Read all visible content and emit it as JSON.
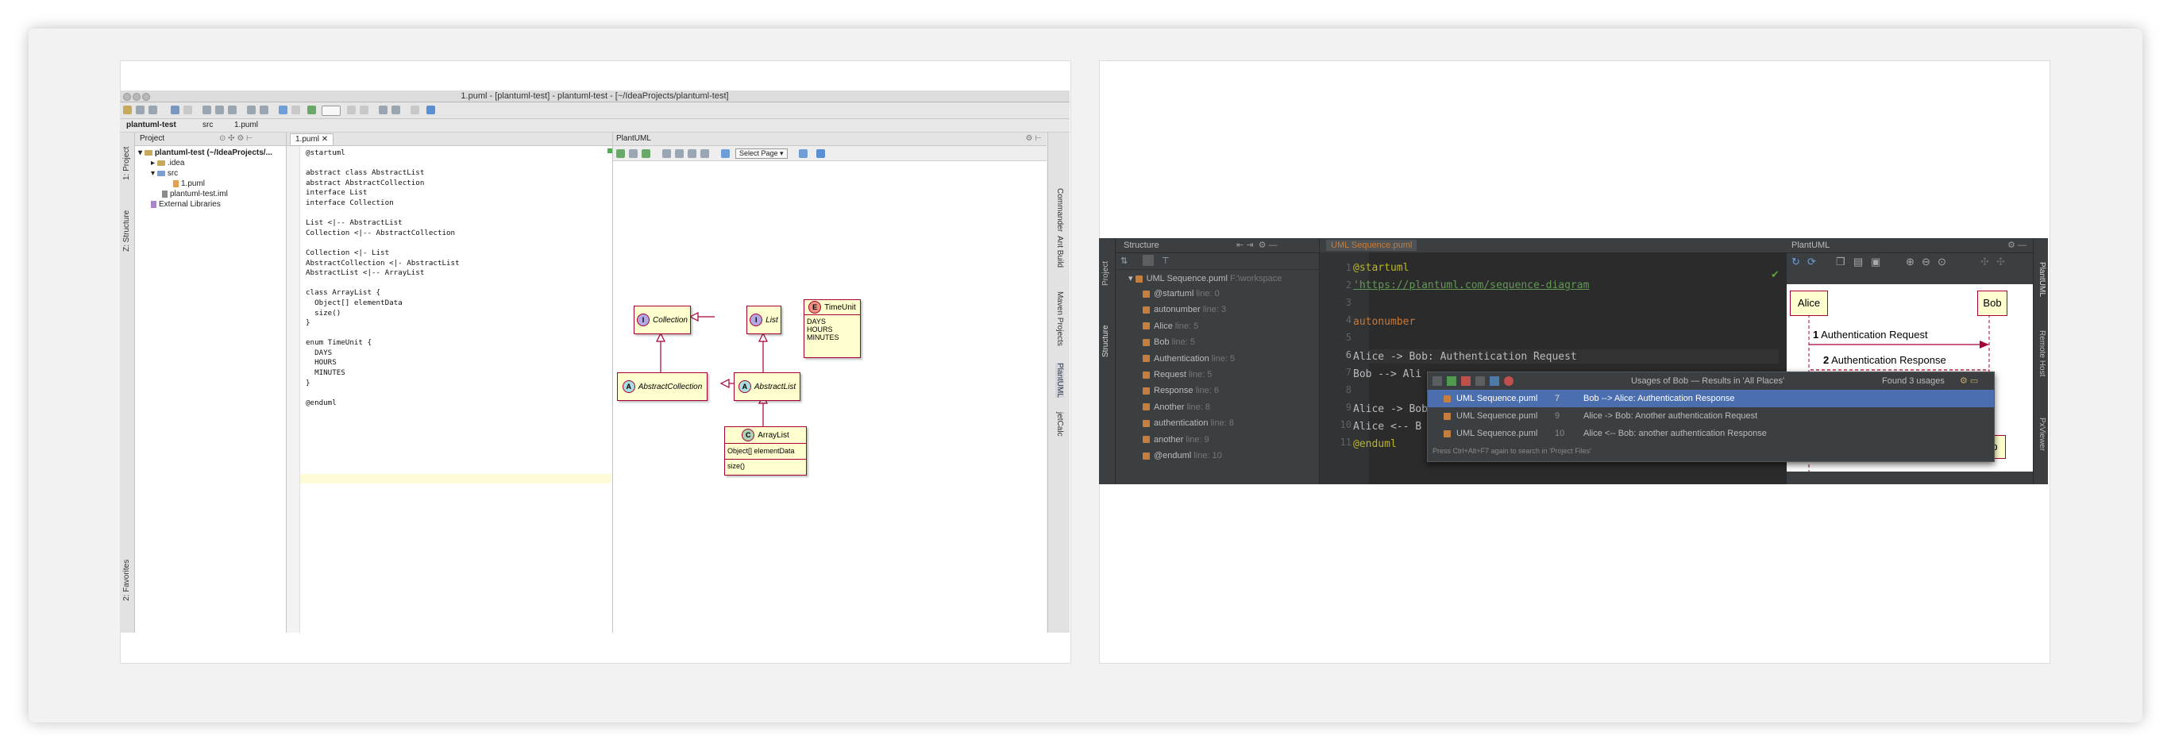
{
  "left_ide": {
    "window_title": "1.puml - [plantuml-test] - plantuml-test - [~/IdeaProjects/plantuml-test]",
    "breadcrumbs": [
      "plantuml-test",
      "src",
      "1.puml"
    ],
    "project_header": "Project",
    "left_tool_tabs": [
      "1: Project",
      "Z: Structure",
      "2: Favorites"
    ],
    "right_tool_tabs": [
      "Commander",
      "Ant Build",
      "Maven Projects",
      "PlantUML",
      "jetCalc"
    ],
    "tree": {
      "root": "plantuml-test (~/IdeaProjects/...",
      "idea": ".idea",
      "src": "src",
      "file": "1.puml",
      "iml": "plantuml-test.iml",
      "libs": "External Libraries"
    },
    "editor_tab": "1.puml",
    "code_lines": [
      "@startuml",
      "",
      "abstract class AbstractList",
      "abstract AbstractCollection",
      "interface List",
      "interface Collection",
      "",
      "List <|-- AbstractList",
      "Collection <|-- AbstractCollection",
      "",
      "Collection <|- List",
      "AbstractCollection <|- AbstractList",
      "AbstractList <|-- ArrayList",
      "",
      "class ArrayList {",
      "  Object[] elementData",
      "  size()",
      "}",
      "",
      "enum TimeUnit {",
      "  DAYS",
      "  HOURS",
      "  MINUTES",
      "}",
      "",
      "@enduml"
    ],
    "plantuml_header": "PlantUML",
    "select_page": "Select Page",
    "diagram": {
      "collection": "Collection",
      "list": "List",
      "timeunit": "TimeUnit",
      "timeunit_values": [
        "DAYS",
        "HOURS",
        "MINUTES"
      ],
      "abstract_collection": "AbstractCollection",
      "abstract_list": "AbstractList",
      "arraylist": "ArrayList",
      "arraylist_field": "Object[] elementData",
      "arraylist_method": "size()",
      "stereo_i": "I",
      "stereo_a": "A",
      "stereo_c": "C",
      "stereo_e": "E"
    }
  },
  "right_ide": {
    "left_tabs": [
      "Project",
      "Structure"
    ],
    "structure_header": "Structure",
    "structure_root": "UML Sequence.puml",
    "structure_root_path": "F:\\workspace",
    "structure_items": [
      {
        "name": "@startuml",
        "line": "line: 0"
      },
      {
        "name": "autonumber",
        "line": "line: 3"
      },
      {
        "name": "Alice",
        "line": "line: 5"
      },
      {
        "name": "Bob",
        "line": "line: 5"
      },
      {
        "name": "Authentication",
        "line": "line: 5"
      },
      {
        "name": "Request",
        "line": "line: 5"
      },
      {
        "name": "Response",
        "line": "line: 6"
      },
      {
        "name": "Another",
        "line": "line: 8"
      },
      {
        "name": "authentication",
        "line": "line: 8"
      },
      {
        "name": "another",
        "line": "line: 9"
      },
      {
        "name": "@enduml",
        "line": "line: 10"
      }
    ],
    "editor_tab": "UML Sequence.puml",
    "line_numbers": [
      "1",
      "2",
      "3",
      "4",
      "5",
      "6",
      "7",
      "8",
      "9",
      "10",
      "11"
    ],
    "code": {
      "l1": "@startuml",
      "l2": "'https://plantuml.com/sequence-diagram",
      "l4": "autonumber",
      "l6": "Alice -> Bob: Authentication Request",
      "l7": "Bob --> Ali",
      "l9": "Alice -> Bob",
      "l10": "Alice <-- B",
      "l11": "@enduml"
    },
    "usages_popup": {
      "title": "Usages of Bob — Results in 'All Places'",
      "count": "Found 3 usages",
      "rows": [
        {
          "file": "UML Sequence.puml",
          "line": "7",
          "text": "Bob --> Alice: Authentication Response"
        },
        {
          "file": "UML Sequence.puml",
          "line": "9",
          "text": "Alice -> Bob: Another authentication Request"
        },
        {
          "file": "UML Sequence.puml",
          "line": "10",
          "text": "Alice <-- Bob: another authentication Response"
        }
      ],
      "hint": "Press Ctrl+Alt+F7 again to search in 'Project Files'"
    },
    "plantuml_header": "PlantUML",
    "seq": {
      "alice": "Alice",
      "bob": "Bob",
      "m1_num": "1",
      "m1_text": "Authentication Request",
      "m2_num": "2",
      "m2_text": "Authentication Response",
      "bob_bottom": "b"
    },
    "right_tabs": [
      "PlantUML",
      "Remote Host",
      "PxViewer"
    ]
  },
  "colors": {
    "uml_fill": "#fefece",
    "uml_border": "#a80036",
    "dark_bg": "#2b2b2b",
    "selection": "#4b6eaf"
  }
}
